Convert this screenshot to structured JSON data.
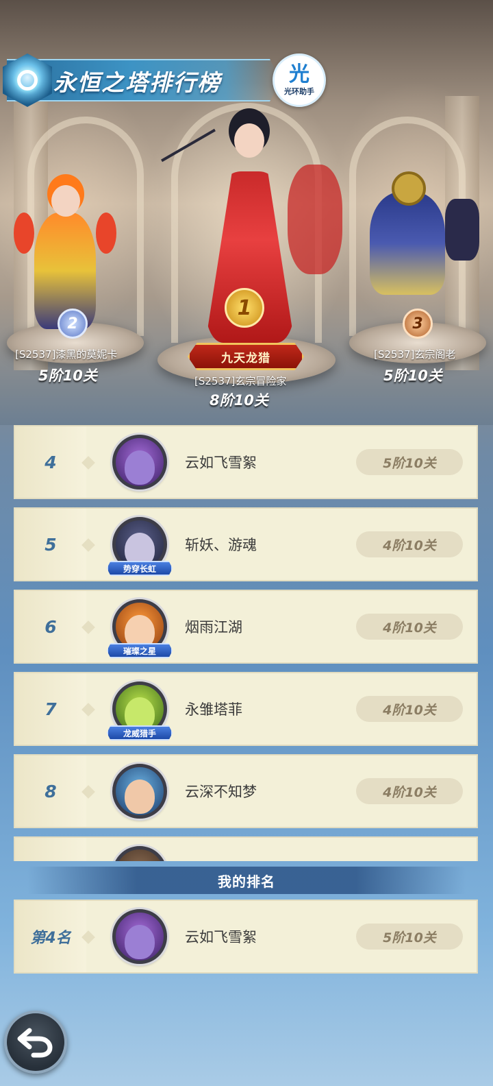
{
  "header": {
    "title": "永恒之塔排行榜",
    "helper_badge_glyph": "光",
    "helper_badge_label": "光环助手"
  },
  "podium": {
    "first": {
      "medal": "1",
      "title_plate": "九天龙猎",
      "name": "[S2537]玄宗冒险家",
      "score": "8阶10关"
    },
    "second": {
      "medal": "2",
      "name": "[S2537]漆黑的莫妮卡",
      "score": "5阶10关"
    },
    "third": {
      "medal": "3",
      "name": "[S2537]玄宗阁老",
      "score": "5阶10关"
    }
  },
  "list": {
    "rows": [
      {
        "rank": "4",
        "name": "云如飞雪絮",
        "score": "5阶10关",
        "avatar_tag": ""
      },
      {
        "rank": "5",
        "name": "斩妖、游魂",
        "score": "4阶10关",
        "avatar_tag": "势穿长虹"
      },
      {
        "rank": "6",
        "name": "烟雨江湖",
        "score": "4阶10关",
        "avatar_tag": "璀璨之星"
      },
      {
        "rank": "7",
        "name": "永雏塔菲",
        "score": "4阶10关",
        "avatar_tag": "龙威猎手"
      },
      {
        "rank": "8",
        "name": "云深不知梦",
        "score": "4阶10关",
        "avatar_tag": ""
      }
    ]
  },
  "my_rank": {
    "header": "我的排名",
    "rank": "第4名",
    "name": "云如飞雪絮",
    "score": "5阶10关"
  },
  "colors": {
    "row_bg": "#f3f0d8",
    "rank_text": "#3f6f9a",
    "score_pill": "#e4ddc4"
  },
  "icons": {
    "title_emblem": "tower-emblem-icon",
    "back": "back-arrow-icon"
  }
}
